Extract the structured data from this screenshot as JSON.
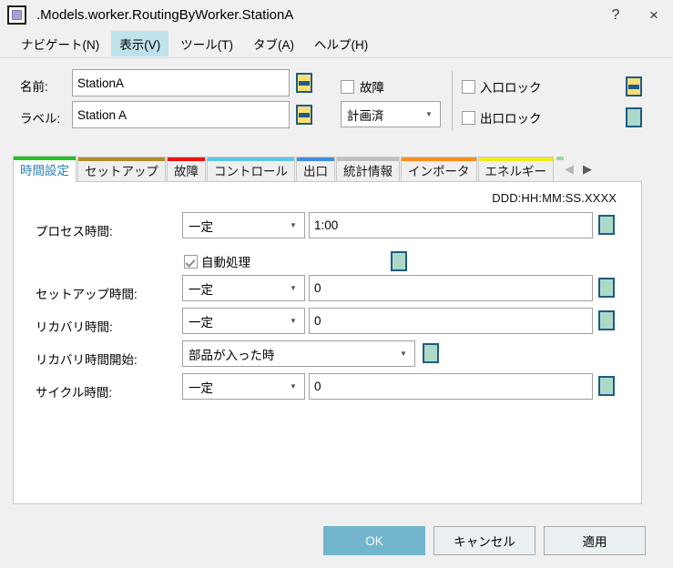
{
  "window": {
    "title": ".Models.worker.RoutingByWorker.StationA",
    "icon": "station-object-icon",
    "help_label": "?",
    "close_label": "×"
  },
  "menubar": {
    "items": [
      {
        "label": "ナビゲート(N)",
        "active": false
      },
      {
        "label": "表示(V)",
        "active": true
      },
      {
        "label": "ツール(T)",
        "active": false
      },
      {
        "label": "タブ(A)",
        "active": false
      },
      {
        "label": "ヘルプ(H)",
        "active": false
      }
    ]
  },
  "topform": {
    "name_label": "名前:",
    "name_value": "StationA",
    "label_label": "ラベル:",
    "label_value": "Station A",
    "failure_checkbox_label": "故障",
    "failure_checked": false,
    "status_combo_value": "計画済",
    "entrance_lock_label": "入口ロック",
    "entrance_lock_checked": false,
    "exit_lock_label": "出口ロック",
    "exit_lock_checked": false
  },
  "tabs": [
    {
      "label": "時間設定",
      "color": "#1fc31f",
      "active": true
    },
    {
      "label": "セットアップ",
      "color": "#b08a2e",
      "active": false
    },
    {
      "label": "故障",
      "color": "#ee1111",
      "active": false
    },
    {
      "label": "コントロール",
      "color": "#5cc8e8",
      "active": false
    },
    {
      "label": "出口",
      "color": "#3f8fe0",
      "active": false
    },
    {
      "label": "統計情報",
      "color": "#c0c0c0",
      "active": false
    },
    {
      "label": "インポータ",
      "color": "#ff8c1a",
      "active": false
    },
    {
      "label": "エネルギー",
      "color": "#f2ea19",
      "active": false
    }
  ],
  "tab_nav": {
    "prev_icon": "chevron-left-icon",
    "next_icon": "chevron-right-icon"
  },
  "panel": {
    "format_hint": "DDD:HH:MM:SS.XXXX",
    "rows": [
      {
        "label": "プロセス時間:",
        "combo": "一定",
        "value": "1:00"
      },
      {
        "label": "セットアップ時間:",
        "combo": "一定",
        "value": "0"
      },
      {
        "label": "リカバリ時間:",
        "combo": "一定",
        "value": "0"
      },
      {
        "label": "サイクル時間:",
        "combo": "一定",
        "value": "0"
      }
    ],
    "auto_process_label": "自動処理",
    "auto_process_checked": true,
    "recovery_start_label": "リカバリ時間開始:",
    "recovery_start_value": "部品が入った時"
  },
  "footer": {
    "ok_label": "OK",
    "cancel_label": "キャンセル",
    "apply_label": "適用"
  },
  "colors": {
    "accent": "#72b5cc",
    "menu_highlight": "#bfe3ec",
    "active_tab_text": "#2a7fb8",
    "swatch_yellow": "#fadf78",
    "swatch_green": "#addac8",
    "swatch_border": "#1f5b85"
  }
}
